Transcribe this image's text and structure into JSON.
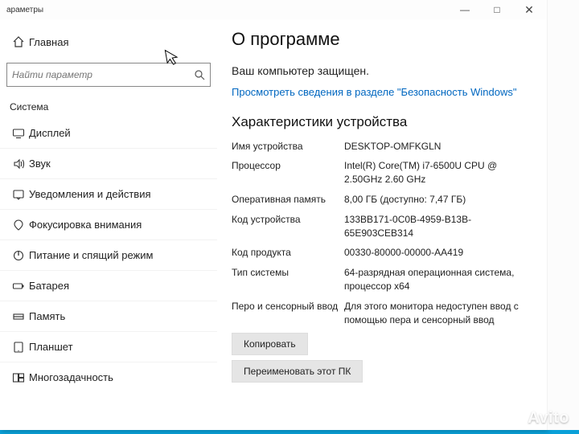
{
  "window": {
    "title": "араметры",
    "minimize": "—",
    "maximize": "□",
    "close": "✕"
  },
  "sidebar": {
    "home_label": "Главная",
    "search_placeholder": "Найти параметр",
    "section_label": "Система",
    "items": [
      {
        "icon": "display",
        "label": "Дисплей"
      },
      {
        "icon": "sound",
        "label": "Звук"
      },
      {
        "icon": "notify",
        "label": "Уведомления и действия"
      },
      {
        "icon": "focus",
        "label": "Фокусировка внимания"
      },
      {
        "icon": "power",
        "label": "Питание и спящий режим"
      },
      {
        "icon": "battery",
        "label": "Батарея"
      },
      {
        "icon": "storage",
        "label": "Память"
      },
      {
        "icon": "tablet",
        "label": "Планшет"
      },
      {
        "icon": "multi",
        "label": "Многозадачность"
      }
    ]
  },
  "content": {
    "title": "О программе",
    "status": "Ваш компьютер защищен.",
    "link": "Просмотреть сведения в разделе \"Безопасность Windows\"",
    "specs_heading": "Характеристики устройства",
    "specs": [
      {
        "k": "Имя устройства",
        "v": "DESKTOP-OMFKGLN"
      },
      {
        "k": "Процессор",
        "v": "Intel(R) Core(TM) i7-6500U CPU @ 2.50GHz   2.60 GHz"
      },
      {
        "k": "Оперативная память",
        "v": "8,00 ГБ (доступно: 7,47 ГБ)"
      },
      {
        "k": "Код устройства",
        "v": "133BB171-0C0B-4959-B13B-65E903CEB314"
      },
      {
        "k": "Код продукта",
        "v": "00330-80000-00000-AA419"
      },
      {
        "k": "Тип системы",
        "v": "64-разрядная операционная система, процессор x64"
      },
      {
        "k": "Перо и сенсорный ввод",
        "v": "Для этого монитора недоступен ввод с помощью пера и сенсорный ввод"
      }
    ],
    "copy_btn": "Копировать",
    "rename_btn": "Переименовать этот ПК"
  },
  "watermark": "Avito"
}
